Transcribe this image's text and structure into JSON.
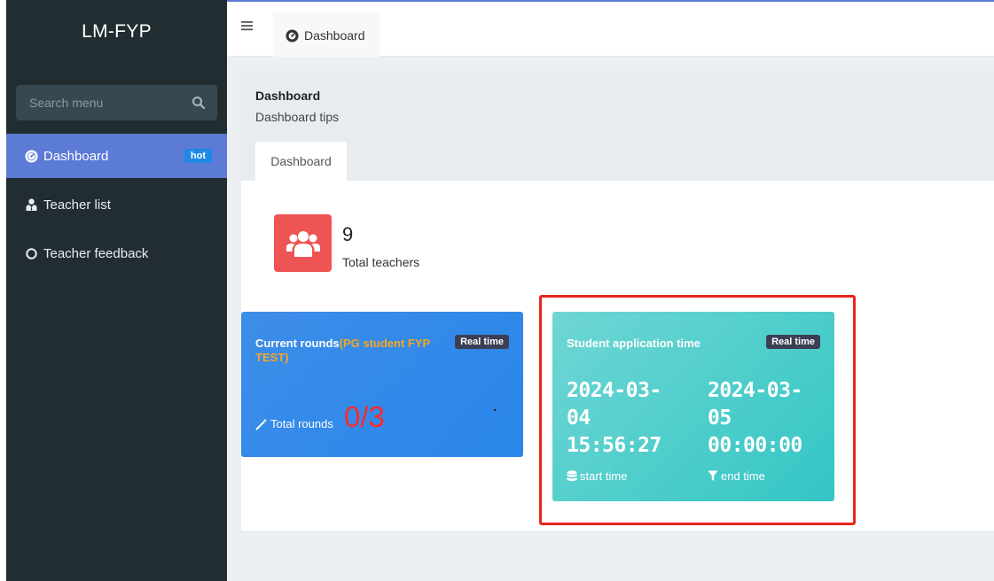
{
  "brand": "LM-FYP",
  "search": {
    "placeholder": "Search menu",
    "icon": "search-icon"
  },
  "sidebar": {
    "items": [
      {
        "label": "Dashboard",
        "icon": "dashboard-icon",
        "badge": "hot",
        "active": true
      },
      {
        "label": "Teacher list",
        "icon": "user-tie-icon"
      },
      {
        "label": "Teacher feedback",
        "icon": "circle-icon"
      }
    ]
  },
  "topbar": {
    "menu_icon": "hamburger-icon",
    "tab_label": "Dashboard",
    "tab_icon": "dashboard-icon"
  },
  "panel": {
    "title": "Dashboard",
    "tips": "Dashboard tips",
    "tab_label": "Dashboard"
  },
  "stats": {
    "value": "9",
    "label": "Total teachers",
    "icon": "users-icon"
  },
  "rounds_card": {
    "title": "Current rounds",
    "title_highlight": "(PG student FYP TEST)",
    "badge": "Real time",
    "label": "Total rounds",
    "label_icon": "magic-wand-icon",
    "value": "0/3"
  },
  "application_card": {
    "title": "Student application time",
    "badge": "Real time",
    "start_value": "2024-03-04 15:56:27",
    "end_value": "2024-03-05 00:00:00",
    "start_label": "start time",
    "end_label": "end time",
    "start_icon": "database-icon",
    "end_icon": "filter-icon"
  },
  "colors": {
    "sidebar_bg": "#222d32",
    "active_item": "#5b7bd5",
    "hot_badge": "#1e88e5",
    "stat_icon_bg": "#ee5454",
    "rounds_card": "#2a86ea",
    "application_card": "#33c6c4",
    "highlight": "#e8261c"
  }
}
